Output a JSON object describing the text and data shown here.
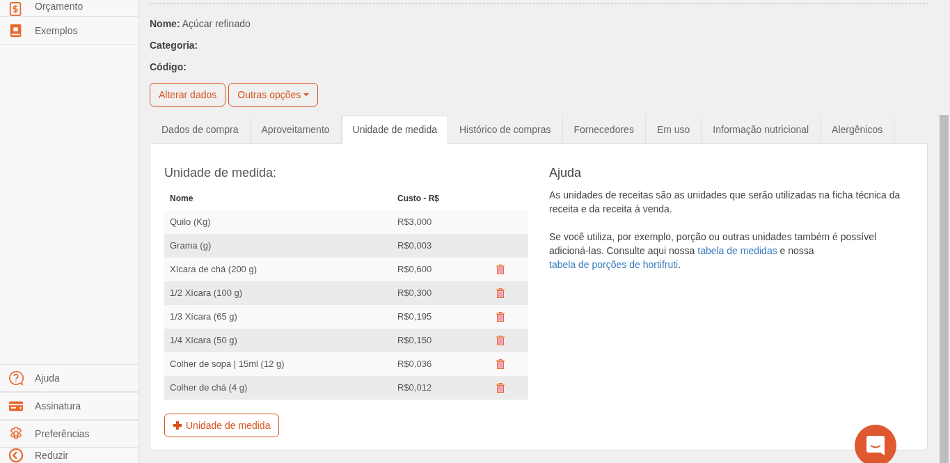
{
  "sidebar": {
    "top_items": [
      {
        "label": "Orçamento"
      },
      {
        "label": "Exemplos"
      }
    ],
    "bottom_items": [
      {
        "label": "Ajuda"
      },
      {
        "label": "Assinatura"
      },
      {
        "label": "Preferências"
      },
      {
        "label": "Reduzir"
      }
    ]
  },
  "product": {
    "fields": [
      {
        "label": "Nome:",
        "value": "Açúcar refinado"
      },
      {
        "label": "Categoria:"
      },
      {
        "label": "Código:"
      }
    ],
    "buttons": [
      {
        "label": "Alterar dados",
        "dropdown": false
      },
      {
        "label": "Outras opções",
        "dropdown": true
      }
    ]
  },
  "tabs": [
    {
      "label": "Dados de compra",
      "selected": false
    },
    {
      "label": "Aproveitamento",
      "selected": false
    },
    {
      "label": "Unidade de medida",
      "selected": true
    },
    {
      "label": "Histórico de compras",
      "selected": false
    },
    {
      "label": "Fornecedores",
      "selected": false
    },
    {
      "label": "Em uso",
      "selected": false
    },
    {
      "label": "Informação nutricional",
      "selected": false
    },
    {
      "label": "Alergênicos",
      "selected": false
    }
  ],
  "units": {
    "title": "Unidade de medida:",
    "columns": [
      "Nome",
      "Custo - R$"
    ],
    "rows": [
      {
        "name": "Quilo (Kg)",
        "cost": "R$3,000",
        "deletable": false
      },
      {
        "name": "Grama (g)",
        "cost": "R$0,003",
        "deletable": false
      },
      {
        "name": "Xícara de chá (200 g)",
        "cost": "R$0,600",
        "deletable": true
      },
      {
        "name": "1/2 Xícara (100 g)",
        "cost": "R$0,300",
        "deletable": true
      },
      {
        "name": "1/3 Xícara (65 g)",
        "cost": "R$0,195",
        "deletable": true
      },
      {
        "name": "1/4 Xícara (50 g)",
        "cost": "R$0,150",
        "deletable": true
      },
      {
        "name": "Colher de sopa | 15ml (12 g)",
        "cost": "R$0,036",
        "deletable": true
      },
      {
        "name": "Colher de chá (4 g)",
        "cost": "R$0,012",
        "deletable": true
      }
    ],
    "add_button": "Unidade de medida"
  },
  "help": {
    "title": "Ajuda",
    "paragraphs": [
      [
        {
          "text": "As unidades de receitas são as unidades que serão utilizadas na ficha técnica da receita e da receita à venda."
        }
      ],
      [
        {
          "text": "Se você utiliza, por exemplo, porção ou outras unidades também é possível adicioná-las. Consulte aqui nossa "
        },
        {
          "text": "tabela de medidas",
          "link": true
        },
        {
          "text": " e nossa "
        },
        {
          "text": "tabela de porções de hortifruti",
          "link": true
        },
        {
          "text": "."
        }
      ]
    ]
  }
}
